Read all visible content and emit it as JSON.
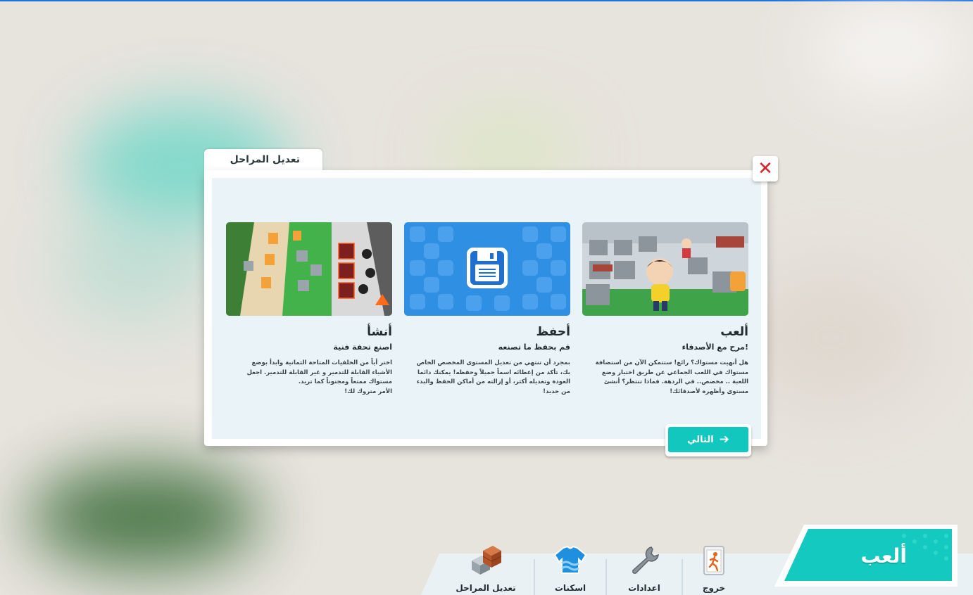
{
  "modal": {
    "tab_title": "تعديل المراحل",
    "close_symbol": "✕",
    "cards": [
      {
        "title": "ألعب",
        "subtitle": "مرح مع الأصدقاء!",
        "body": "هل أنهيت مستواك؟ رائع! ستتمكن الآن من استضافة مستواك في اللعب الجماعي عن طريق اختيار وضع اللعبة .. مخصص.. في الردهة. فماذا تنتظر؟ أنشئ مستوى وأظهره لأصدقائك!",
        "image": "gameplay-screenshot"
      },
      {
        "title": "أحفظ",
        "subtitle": "قم بحفظ ما تصنعه",
        "body": "بمجرد أن تنتهي من تعديل المستوى المخصص الخاص بك، تأكد من إعطائه اسماً جميلاً وحفظه! يمكنك دائما العودة وتعديله أكثر، أو إزالته من أماكن الحفظ والبدء من جديد!",
        "image": "save-floppy-icon"
      },
      {
        "title": "أنشأ",
        "subtitle": "اصنع تحفة فنية",
        "body": "اختر أياً من الخلفيات المتاحة الثمانية وابدأ بوضع الأشياء القابلة للتدمير و غير القابلة للتدمير. اجعل مستواك ممتعاً ومجنوناً كما تريد.",
        "body2": "الأمر متروك لك!",
        "image": "level-editor-screenshot"
      }
    ],
    "next_label": "التالي",
    "next_icon": "arrow-right-icon"
  },
  "bottom_bar": {
    "items": [
      {
        "label": "تعديل المراحل",
        "icon": "crates-icon"
      },
      {
        "label": "اسكنات",
        "icon": "sweater-icon"
      },
      {
        "label": "اعدادات",
        "icon": "wrench-icon"
      },
      {
        "label": "خروج",
        "icon": "exit-door-icon"
      }
    ],
    "play_label": "ألعب"
  },
  "colors": {
    "accent": "#14c9bf",
    "close": "#d8232a",
    "save_card_bg": "#2f8fe3",
    "top_line": "#1f6fe0"
  }
}
